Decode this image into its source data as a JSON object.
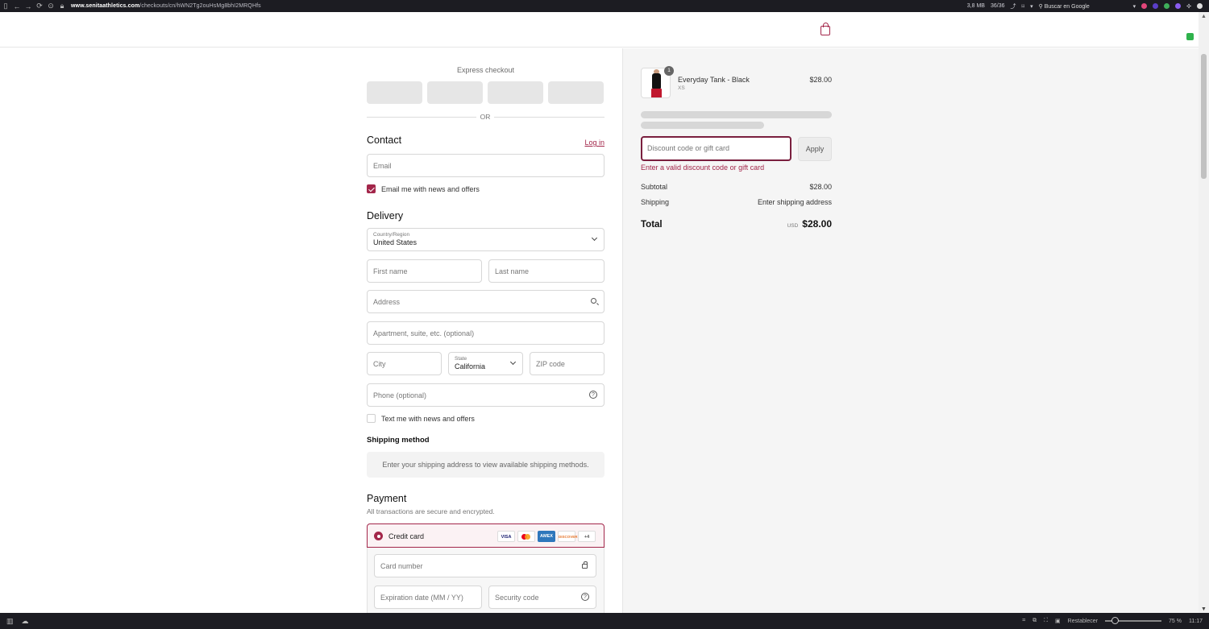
{
  "browser": {
    "url_domain": "www.senitaathletics.com",
    "url_path": "/checkouts/cn/hWN2Tg2ouHsMg8bhI2MRQHfs",
    "memory": "3,8 MB",
    "tabs_count": "36/36",
    "search_placeholder": "Buscar en Google"
  },
  "taskbar": {
    "reset_label": "Restablecer",
    "zoom": "75 %",
    "time": "11:17"
  },
  "express": {
    "title": "Express checkout",
    "or": "OR"
  },
  "contact": {
    "title": "Contact",
    "login": "Log in",
    "email_placeholder": "Email",
    "news_label": "Email me with news and offers"
  },
  "delivery": {
    "title": "Delivery",
    "country_label": "Country/Region",
    "country_value": "United States",
    "first_name": "First name",
    "last_name": "Last name",
    "address": "Address",
    "apartment": "Apartment, suite, etc. (optional)",
    "city": "City",
    "state_label": "State",
    "state_value": "California",
    "zip": "ZIP code",
    "phone": "Phone (optional)",
    "text_label": "Text me with news and offers"
  },
  "shipping": {
    "title": "Shipping method",
    "message": "Enter your shipping address to view available shipping methods."
  },
  "payment": {
    "title": "Payment",
    "subtitle": "All transactions are secure and encrypted.",
    "method": "Credit card",
    "cards": [
      "VISA",
      "MC",
      "AMEX",
      "DISCOVER",
      "+4"
    ],
    "card_number": "Card number",
    "expiration": "Expiration date (MM / YY)",
    "security": "Security code"
  },
  "summary": {
    "product_qty": "1",
    "product_name": "Everyday Tank - Black",
    "product_variant": "XS",
    "product_price": "$28.00",
    "discount_placeholder": "Discount code or gift card",
    "apply": "Apply",
    "discount_error": "Enter a valid discount code or gift card",
    "subtotal_label": "Subtotal",
    "subtotal_value": "$28.00",
    "shipping_label": "Shipping",
    "shipping_value": "Enter shipping address",
    "total_label": "Total",
    "currency": "USD",
    "total_value": "$28.00"
  },
  "colors": {
    "accent": "#a3264a",
    "focus_border": "#7a1f3e",
    "summary_bg": "#f5f5f5"
  }
}
